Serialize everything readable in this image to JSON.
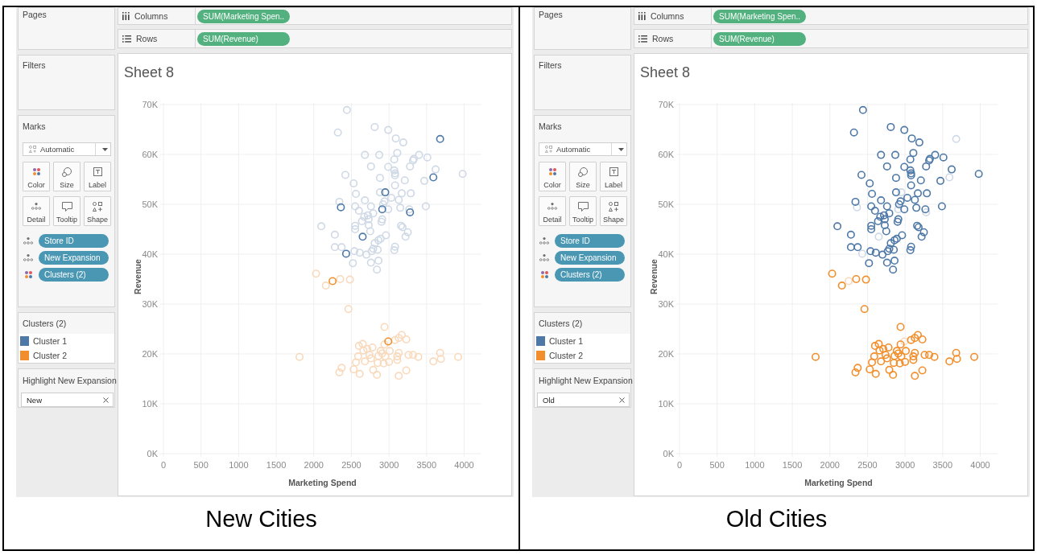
{
  "panels": [
    {
      "pages_card": {
        "title": "Pages"
      },
      "columns_shelf": {
        "label": "Columns",
        "pill": "SUM(Marketing Spen.."
      },
      "rows_shelf": {
        "label": "Rows",
        "pill": "SUM(Revenue)"
      },
      "filters_card": {
        "title": "Filters"
      },
      "marks_card": {
        "title": "Marks",
        "mark_type": "Automatic",
        "buttons": [
          {
            "kind": "color",
            "label": "Color"
          },
          {
            "kind": "size",
            "label": "Size"
          },
          {
            "kind": "label",
            "label": "Label"
          },
          {
            "kind": "detail",
            "label": "Detail"
          },
          {
            "kind": "tooltip",
            "label": "Tooltip"
          },
          {
            "kind": "shape",
            "label": "Shape"
          }
        ],
        "fields": [
          {
            "kind": "detail",
            "label": "Store ID"
          },
          {
            "kind": "detail",
            "label": "New Expansion"
          },
          {
            "kind": "color",
            "label": "Clusters (2)"
          }
        ]
      },
      "legend": {
        "title": "Clusters (2)"
      },
      "highlighter": {
        "title": "Highlight New Expansion",
        "value": "New"
      },
      "sheet": {
        "title": "Sheet 8",
        "chart_data": {
          "type": "scatter",
          "xlabel": "Marketing Spend",
          "ylabel": "Revenue",
          "grid": true,
          "xlim": [
            0,
            4230
          ],
          "ylim": [
            0,
            70000
          ],
          "xticks": [
            0,
            500,
            1000,
            1500,
            2000,
            2500,
            3000,
            3500,
            4000
          ],
          "yticks": [
            {
              "value": 0,
              "label": "0K"
            },
            {
              "value": 10000,
              "label": "10K"
            },
            {
              "value": 20000,
              "label": "20K"
            },
            {
              "value": 30000,
              "label": "30K"
            },
            {
              "value": 40000,
              "label": "40K"
            },
            {
              "value": 50000,
              "label": "50K"
            },
            {
              "value": 60000,
              "label": "60K"
            },
            {
              "value": 70000,
              "label": "70K"
            }
          ],
          "series": [
            {
              "color": "#cfd9e6",
              "x": [
                2440,
                2320,
                2810,
                2990,
                3090,
                3190,
                2680,
                2870,
                3110,
                3070,
                3330,
                3400,
                3510,
                3320,
                2760,
                2990,
                3070,
                3080,
                3080,
                3280,
                3620,
                2420,
                2880,
                3980,
                3210,
                3470,
                2530,
                3080,
                2560,
                2880,
                3170,
                3290,
                3030,
                3130,
                2680,
                2340,
                2550,
                2760,
                2990,
                2940,
                2920,
                3150,
                3270,
                3490,
                2600,
                2790,
                2720,
                2670,
                2730,
                2910,
                2900,
                2640,
                2100,
                2550,
                2550,
                2730,
                2750,
                3160,
                3180,
                3250,
                3220,
                2280,
                2960,
                2890,
                2860,
                2810,
                2790,
                2850,
                2770,
                3080,
                3070,
                2280,
                2370,
                2540,
                2610,
                2700,
                2520,
                2760,
                2860,
                2840
              ],
              "values": [
                68900,
                64400,
                65500,
                64900,
                63200,
                62400,
                59900,
                59900,
                60300,
                59000,
                59100,
                59900,
                59400,
                58800,
                57600,
                57500,
                56800,
                56200,
                55800,
                57600,
                57000,
                55900,
                55300,
                56100,
                54800,
                54700,
                54200,
                53800,
                52100,
                52400,
                52200,
                52200,
                51300,
                50900,
                50800,
                50500,
                49600,
                49600,
                49000,
                50600,
                50000,
                49300,
                49000,
                49600,
                48700,
                48200,
                47800,
                47500,
                47000,
                47000,
                46500,
                46600,
                45600,
                45700,
                45000,
                45800,
                44600,
                45700,
                45400,
                44400,
                43500,
                43900,
                43800,
                43100,
                42800,
                42200,
                41100,
                40900,
                40600,
                41500,
                40800,
                41400,
                41400,
                40600,
                40300,
                39900,
                38200,
                38300,
                38700,
                36900
              ]
            },
            {
              "color": "#f8d9bc",
              "x": [
                2030,
                2160,
                2350,
                2480,
                2460,
                1810,
                2940,
                3080,
                3170,
                3130,
                3230,
                2600,
                2650,
                2660,
                2710,
                2780,
                2940,
                2890,
                2910,
                3010,
                2590,
                2740,
                2760,
                2860,
                2950,
                2560,
                2680,
                2850,
                2930,
                3000,
                3130,
                3110,
                3110,
                3260,
                3320,
                3390,
                3590,
                3680,
                3690,
                3920,
                2370,
                2340,
                2530,
                2610,
                2790,
                2840,
                3130,
                3230
              ],
              "values": [
                36100,
                33700,
                35000,
                34900,
                29000,
                19400,
                25400,
                22800,
                23800,
                23200,
                22900,
                21600,
                22000,
                20700,
                21000,
                21300,
                21900,
                20600,
                20100,
                20600,
                19500,
                19800,
                19100,
                19600,
                19500,
                18300,
                18500,
                18200,
                18100,
                18400,
                20200,
                19500,
                18800,
                19800,
                19800,
                19400,
                18500,
                20200,
                19000,
                19400,
                17200,
                16300,
                16900,
                16000,
                16800,
                15800,
                15600,
                16700
              ]
            },
            {
              "name": "Cluster 1",
              "color": "#4e79a7",
              "x": [
                3680,
                3590,
                2950,
                2360,
                2910,
                3280,
                2650,
                2430
              ],
              "values": [
                63100,
                55400,
                52400,
                49400,
                49000,
                48400,
                43500,
                40100
              ]
            },
            {
              "name": "Cluster 2",
              "color": "#f28e2b",
              "x": [
                2250,
                2990
              ],
              "values": [
                34600,
                22500
              ]
            }
          ]
        }
      },
      "caption": "New Cities"
    },
    {
      "pages_card": {
        "title": "Pages"
      },
      "columns_shelf": {
        "label": "Columns",
        "pill": "SUM(Marketing Spen.."
      },
      "rows_shelf": {
        "label": "Rows",
        "pill": "SUM(Revenue)"
      },
      "filters_card": {
        "title": "Filters"
      },
      "marks_card": {
        "title": "Marks",
        "mark_type": "Automatic",
        "buttons": [
          {
            "kind": "color",
            "label": "Color"
          },
          {
            "kind": "size",
            "label": "Size"
          },
          {
            "kind": "label",
            "label": "Label"
          },
          {
            "kind": "detail",
            "label": "Detail"
          },
          {
            "kind": "tooltip",
            "label": "Tooltip"
          },
          {
            "kind": "shape",
            "label": "Shape"
          }
        ],
        "fields": [
          {
            "kind": "detail",
            "label": "Store ID"
          },
          {
            "kind": "detail",
            "label": "New Expansion"
          },
          {
            "kind": "color",
            "label": "Clusters (2)"
          }
        ]
      },
      "legend": {
        "title": "Clusters (2)"
      },
      "highlighter": {
        "title": "Highlight New Expansion",
        "value": "Old"
      },
      "sheet": {
        "title": "Sheet 8",
        "chart_data": {
          "type": "scatter",
          "xlabel": "Marketing Spend",
          "ylabel": "Revenue",
          "grid": true,
          "xlim": [
            0,
            4230
          ],
          "ylim": [
            0,
            70000
          ],
          "xticks": [
            0,
            500,
            1000,
            1500,
            2000,
            2500,
            3000,
            3500,
            4000
          ],
          "yticks": [
            {
              "value": 0,
              "label": "0K"
            },
            {
              "value": 10000,
              "label": "10K"
            },
            {
              "value": 20000,
              "label": "20K"
            },
            {
              "value": 30000,
              "label": "30K"
            },
            {
              "value": 40000,
              "label": "40K"
            },
            {
              "value": 50000,
              "label": "50K"
            },
            {
              "value": 60000,
              "label": "60K"
            },
            {
              "value": 70000,
              "label": "70K"
            }
          ],
          "series": [
            {
              "color": "#cfd9e6",
              "x": [
                3680,
                3590,
                2950,
                2360,
                2910,
                3280,
                2650,
                2430
              ],
              "values": [
                63100,
                55400,
                52400,
                49400,
                49000,
                48400,
                43500,
                40100
              ]
            },
            {
              "color": "#f8d9bc",
              "x": [
                2250,
                2990
              ],
              "values": [
                34600,
                22500
              ]
            },
            {
              "name": "Cluster 1",
              "color": "#4e79a7",
              "x": [
                2440,
                2320,
                2810,
                2990,
                3090,
                3190,
                2680,
                2870,
                3110,
                3070,
                3330,
                3400,
                3510,
                3320,
                2760,
                2990,
                3070,
                3080,
                3080,
                3280,
                3620,
                2420,
                2880,
                3980,
                3210,
                3470,
                2530,
                3080,
                2560,
                2880,
                3170,
                3290,
                3030,
                3130,
                2680,
                2340,
                2550,
                2760,
                2990,
                2940,
                2920,
                3150,
                3270,
                3490,
                2600,
                2790,
                2720,
                2670,
                2730,
                2910,
                2900,
                2640,
                2100,
                2550,
                2550,
                2730,
                2750,
                3160,
                3180,
                3250,
                3220,
                2280,
                2960,
                2890,
                2860,
                2810,
                2790,
                2850,
                2770,
                3080,
                3070,
                2280,
                2370,
                2540,
                2610,
                2700,
                2520,
                2760,
                2860,
                2840
              ],
              "values": [
                68900,
                64400,
                65500,
                64900,
                63200,
                62400,
                59900,
                59900,
                60300,
                59000,
                59100,
                59900,
                59400,
                58800,
                57600,
                57500,
                56800,
                56200,
                55800,
                57600,
                57000,
                55900,
                55300,
                56100,
                54800,
                54700,
                54200,
                53800,
                52100,
                52400,
                52200,
                52200,
                51300,
                50900,
                50800,
                50500,
                49600,
                49600,
                49000,
                50600,
                50000,
                49300,
                49000,
                49600,
                48700,
                48200,
                47800,
                47500,
                47000,
                47000,
                46500,
                46600,
                45600,
                45700,
                45000,
                45800,
                44600,
                45700,
                45400,
                44400,
                43500,
                43900,
                43800,
                43100,
                42800,
                42200,
                41100,
                40900,
                40600,
                41500,
                40800,
                41400,
                41400,
                40600,
                40300,
                39900,
                38200,
                38300,
                38700,
                36900
              ]
            },
            {
              "name": "Cluster 2",
              "color": "#f28e2b",
              "x": [
                2030,
                2160,
                2350,
                2480,
                2460,
                1810,
                2940,
                3080,
                3170,
                3130,
                3230,
                2600,
                2650,
                2660,
                2710,
                2780,
                2940,
                2890,
                2910,
                3010,
                2590,
                2740,
                2760,
                2860,
                2950,
                2560,
                2680,
                2850,
                2930,
                3000,
                3130,
                3110,
                3110,
                3260,
                3320,
                3390,
                3590,
                3680,
                3690,
                3920,
                2370,
                2340,
                2530,
                2610,
                2790,
                2840,
                3130,
                3230
              ],
              "values": [
                36100,
                33700,
                35000,
                34900,
                29000,
                19400,
                25400,
                22800,
                23800,
                23200,
                22900,
                21600,
                22000,
                20700,
                21000,
                21300,
                21900,
                20600,
                20100,
                20600,
                19500,
                19800,
                19100,
                19600,
                19500,
                18300,
                18500,
                18200,
                18100,
                18400,
                20200,
                19500,
                18800,
                19800,
                19800,
                19400,
                18500,
                20200,
                19000,
                19400,
                17200,
                16300,
                16900,
                16000,
                16800,
                15800,
                15600,
                16700
              ]
            }
          ]
        }
      },
      "caption": "Old Cities"
    }
  ]
}
